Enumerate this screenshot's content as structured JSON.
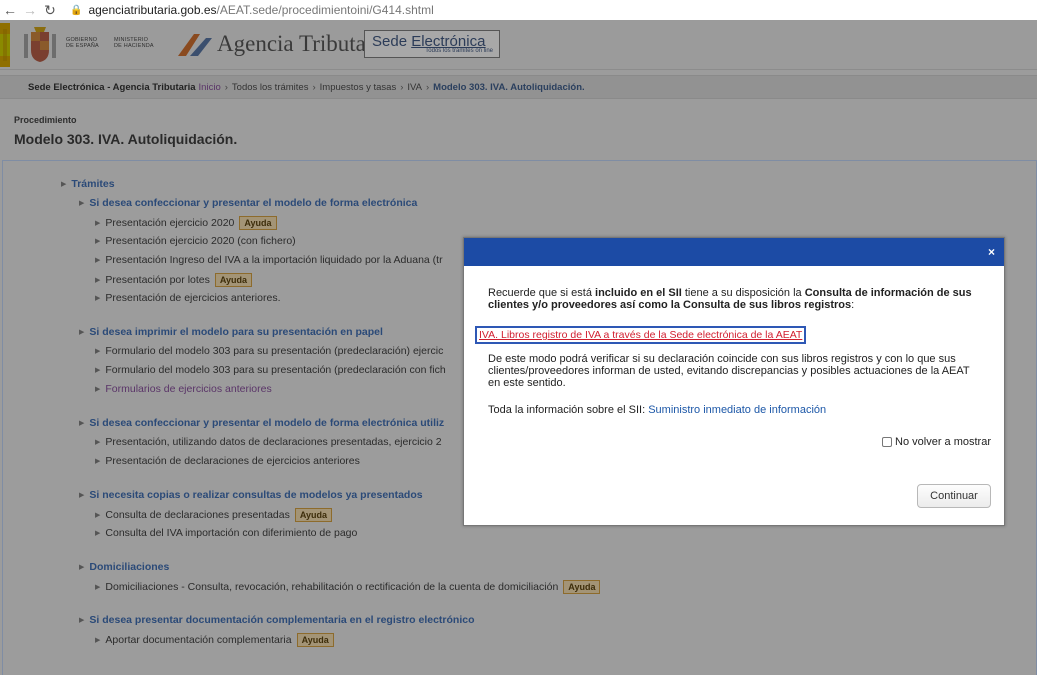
{
  "browser": {
    "url_host": "agenciatributaria.gob.es",
    "url_path": "/AEAT.sede/procedimientoini/G414.shtml"
  },
  "header": {
    "gov_line1": "GOBIERNO",
    "gov_line2": "DE ESPAÑA",
    "min_line1": "MINISTERIO",
    "min_line2": "DE HACIENDA",
    "agency_name": "Agencia Tributaria",
    "sede_prefix": "Sede ",
    "sede_title": "Electrónica",
    "sede_subtitle": "Todos los trámites on line"
  },
  "breadcrumb": {
    "home": "Sede Electrónica - Agencia Tributaria",
    "items": [
      "Inicio",
      "Todos los trámites",
      "Impuestos y tasas",
      "IVA"
    ],
    "current": "Modelo 303. IVA. Autoliquidación.",
    "separator": "›"
  },
  "procedure": {
    "label": "Procedimiento",
    "title": "Modelo 303. IVA. Autoliquidación."
  },
  "tree": {
    "tramites": "Trámites",
    "help_label": "Ayuda",
    "s1": "Si desea confeccionar y presentar el modelo de forma electrónica",
    "s1_items": [
      "Presentación ejercicio 2020",
      "Presentación ejercicio 2020 (con fichero)",
      "Presentación Ingreso del IVA a la importación liquidado por la Aduana (tr",
      "Presentación por lotes",
      "Presentación de ejercicios anteriores."
    ],
    "s2": "Si desea imprimir el modelo para su presentación en papel",
    "s2_items": [
      "Formulario del modelo 303 para su presentación (predeclaración) ejercic",
      "Formulario del modelo 303 para su presentación (predeclaración con fich",
      "Formularios de ejercicios anteriores"
    ],
    "s3": "Si desea confeccionar y presentar el modelo de forma electrónica utiliz",
    "s3_items": [
      "Presentación, utilizando datos de declaraciones presentadas, ejercicio 2",
      "Presentación de declaraciones de ejercicios anteriores"
    ],
    "s4": "Si necesita copias o realizar consultas de modelos ya presentados",
    "s4_items": [
      "Consulta de declaraciones presentadas",
      "Consulta del IVA importación con diferimiento de pago"
    ],
    "s5": "Domiciliaciones",
    "s5_items": [
      "Domiciliaciones - Consulta, revocación, rehabilitación o rectificación de la cuenta de domiciliación"
    ],
    "s6": "Si desea presentar documentación complementaria en el registro electrónico",
    "s6_items": [
      "Aportar documentación complementaria"
    ]
  },
  "modal": {
    "close": "×",
    "p1_a": "Recuerde que si está ",
    "p1_b": "incluido en el SII",
    "p1_c": " tiene a su disposición la ",
    "p1_d": "Consulta de información de sus clientes y/o proveedores así como la Consulta de sus libros registros",
    "p1_e": ":",
    "link": "IVA. Libros registro de IVA a través de la Sede electrónica de la AEAT",
    "p2": "De este modo podrá verificar si su declaración coincide con sus libros registros y con lo que sus clientes/proveedores informan de usted, evitando discrepancias y posibles actuaciones de la AEAT en este sentido.",
    "p3_a": "Toda la información sobre el SII: ",
    "p3_link": "Suministro inmediato de información",
    "checkbox_label": "No volver a mostrar",
    "continue": "Continuar"
  }
}
